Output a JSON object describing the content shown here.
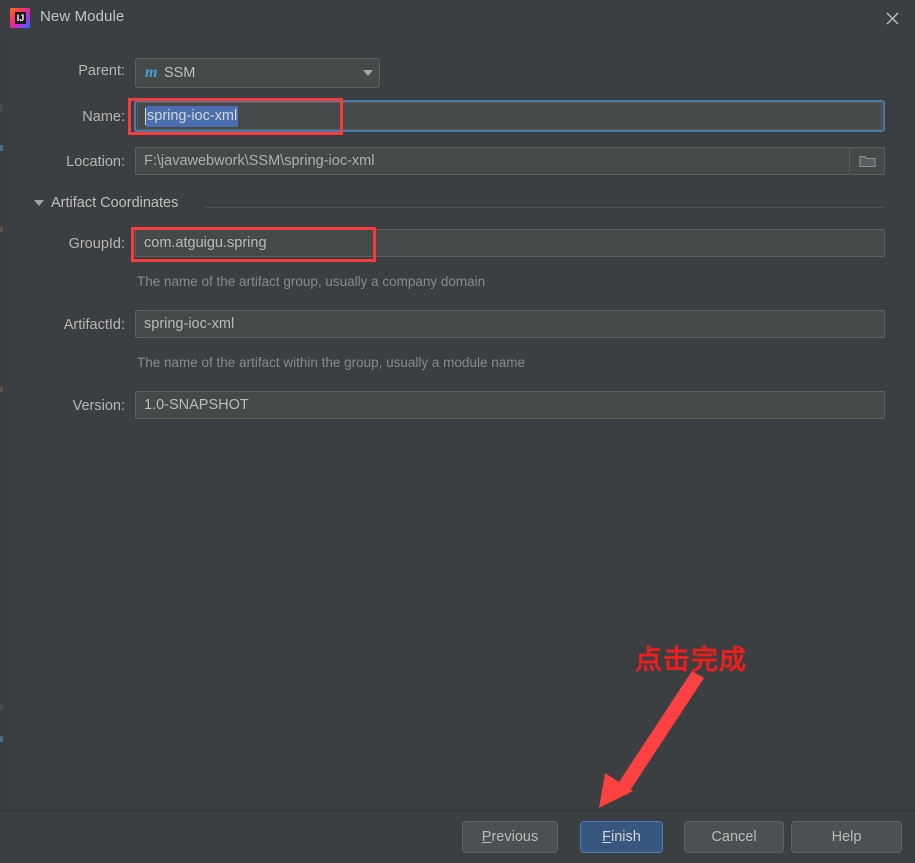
{
  "window": {
    "title": "New Module",
    "app_icon": "intellij-idea-icon",
    "close_icon": "close-icon"
  },
  "form": {
    "parent": {
      "label": "Parent:",
      "icon": "maven-module-icon",
      "icon_glyph": "m",
      "value": "SSM",
      "dropdown_icon": "chevron-down-icon"
    },
    "name": {
      "label": "Name:",
      "value": "spring-ioc-xml",
      "selected": true
    },
    "location": {
      "label": "Location:",
      "value": "F:\\javawebwork\\SSM\\spring-ioc-xml",
      "browse_icon": "folder-icon"
    },
    "artifact_section": {
      "label": "Artifact Coordinates",
      "collapse_icon": "triangle-down-icon",
      "expanded": true
    },
    "group_id": {
      "label": "GroupId:",
      "value": "com.atguigu.spring",
      "hint": "The name of the artifact group, usually a company domain"
    },
    "artifact_id": {
      "label": "ArtifactId:",
      "value": "spring-ioc-xml",
      "hint": "The name of the artifact within the group, usually a module name"
    },
    "version": {
      "label": "Version:",
      "value": "1.0-SNAPSHOT"
    }
  },
  "annotations": {
    "note_text": "点击完成",
    "note_color": "#f01d1d",
    "highlight_color": "#f63c3c",
    "arrow_icon": "arrow-down-left-icon"
  },
  "buttons": {
    "previous": {
      "label": "Previous",
      "mnemonic": "P",
      "rest": "revious"
    },
    "finish": {
      "label": "Finish",
      "mnemonic": "F",
      "rest": "inish",
      "default": true
    },
    "cancel": {
      "label": "Cancel"
    },
    "help": {
      "label": "Help"
    }
  },
  "colors": {
    "dialog_bg": "#3c3f41",
    "field_bg": "#45494a",
    "focus_blue": "#4a7ba7",
    "selection_blue": "#4b6eaf",
    "default_button_blue": "#365880",
    "maven_icon_blue": "#4a9fd4"
  }
}
